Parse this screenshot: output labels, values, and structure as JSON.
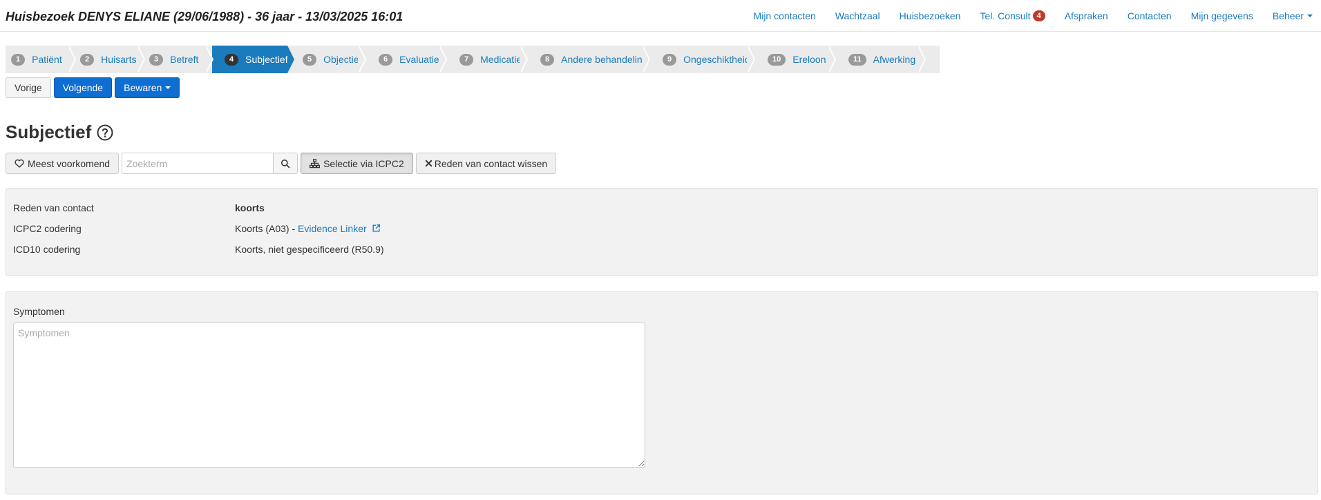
{
  "header": {
    "title": "Huisbezoek DENYS ELIANE (29/06/1988) - 36 jaar - 13/03/2025 16:01"
  },
  "nav": {
    "items": [
      {
        "label": "Mijn contacten"
      },
      {
        "label": "Wachtzaal"
      },
      {
        "label": "Huisbezoeken"
      },
      {
        "label": "Tel. Consult",
        "badge": "4"
      },
      {
        "label": "Afspraken"
      },
      {
        "label": "Contacten"
      },
      {
        "label": "Mijn gegevens"
      },
      {
        "label": "Beheer",
        "dropdown": true
      }
    ]
  },
  "wizard": {
    "active_step": 4,
    "steps": [
      {
        "num": "1",
        "label": "Patiënt"
      },
      {
        "num": "2",
        "label": "Huisarts"
      },
      {
        "num": "3",
        "label": "Betreft"
      },
      {
        "num": "4",
        "label": "Subjectief"
      },
      {
        "num": "5",
        "label": "Objectief"
      },
      {
        "num": "6",
        "label": "Evaluatie"
      },
      {
        "num": "7",
        "label": "Medicatie"
      },
      {
        "num": "8",
        "label": "Andere behandeling"
      },
      {
        "num": "9",
        "label": "Ongeschiktheid"
      },
      {
        "num": "10",
        "label": "Ereloon"
      },
      {
        "num": "11",
        "label": "Afwerking"
      }
    ]
  },
  "actions": {
    "prev": "Vorige",
    "next": "Volgende",
    "save": "Bewaren"
  },
  "section": {
    "title": "Subjectief"
  },
  "toolbar": {
    "frequent": "Meest voorkomend",
    "search_placeholder": "Zoekterm",
    "icpc_select": "Selectie via ICPC2",
    "clear_reason": "Reden van contact wissen"
  },
  "info": {
    "reason_label": "Reden van contact",
    "reason_value": "koorts",
    "icpc_label": "ICPC2 codering",
    "icpc_value": "Koorts (A03) - ",
    "icpc_link": "Evidence Linker",
    "icd_label": "ICD10 codering",
    "icd_value": "Koorts, niet gespecificeerd (R50.9)"
  },
  "symptoms": {
    "label": "Symptomen",
    "placeholder": "Symptomen",
    "value": ""
  },
  "colors": {
    "accent": "#1a7bbd",
    "primary_button": "#0e6ed1",
    "badge": "#c0392b",
    "panel_bg": "#f2f2f2"
  }
}
